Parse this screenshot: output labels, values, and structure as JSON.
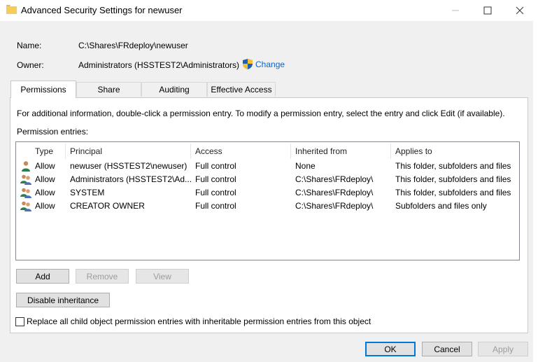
{
  "window": {
    "title": "Advanced Security Settings for newuser"
  },
  "info": {
    "name_label": "Name:",
    "name_value": "C:\\Shares\\FRdeploy\\newuser",
    "owner_label": "Owner:",
    "owner_value": "Administrators (HSSTEST2\\Administrators)",
    "change_label": "Change"
  },
  "tabs": [
    {
      "label": "Permissions",
      "active": true
    },
    {
      "label": "Share",
      "active": false
    },
    {
      "label": "Auditing",
      "active": false
    },
    {
      "label": "Effective Access",
      "active": false
    }
  ],
  "permissions": {
    "info_text": "For additional information, double-click a permission entry. To modify a permission entry, select the entry and click Edit (if available).",
    "entries_label": "Permission entries:",
    "columns": [
      "Type",
      "Principal",
      "Access",
      "Inherited from",
      "Applies to"
    ],
    "rows": [
      {
        "icon": "user-icon",
        "type": "Allow",
        "principal": "newuser (HSSTEST2\\newuser)",
        "access": "Full control",
        "inherited": "None",
        "applies": "This folder, subfolders and files"
      },
      {
        "icon": "group-icon",
        "type": "Allow",
        "principal": "Administrators (HSSTEST2\\Ad...",
        "access": "Full control",
        "inherited": "C:\\Shares\\FRdeploy\\",
        "applies": "This folder, subfolders and files"
      },
      {
        "icon": "group-icon",
        "type": "Allow",
        "principal": "SYSTEM",
        "access": "Full control",
        "inherited": "C:\\Shares\\FRdeploy\\",
        "applies": "This folder, subfolders and files"
      },
      {
        "icon": "group-icon",
        "type": "Allow",
        "principal": "CREATOR OWNER",
        "access": "Full control",
        "inherited": "C:\\Shares\\FRdeploy\\",
        "applies": "Subfolders and files only"
      }
    ]
  },
  "buttons": {
    "add": "Add",
    "remove": "Remove",
    "view": "View",
    "disable_inheritance": "Disable inheritance",
    "ok": "OK",
    "cancel": "Cancel",
    "apply": "Apply"
  },
  "replace_checkbox": {
    "label": "Replace all child object permission entries with inheritable permission entries from this object",
    "checked": false
  },
  "colors": {
    "link": "#0a63c9",
    "ok_border": "#0078d7"
  }
}
